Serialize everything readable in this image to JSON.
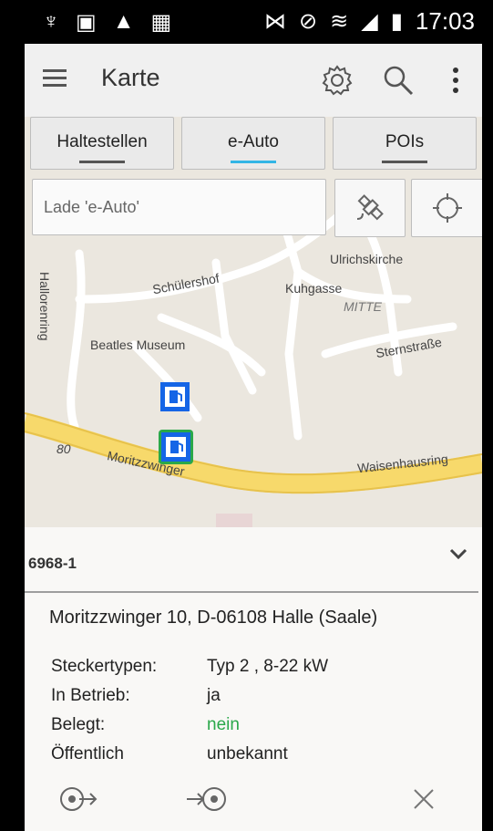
{
  "status": {
    "time": "17:03"
  },
  "app": {
    "title": "Karte"
  },
  "tabs": [
    "Haltestellen",
    "e-Auto",
    "POIs"
  ],
  "search": {
    "placeholder": "Lade 'e-Auto'"
  },
  "map": {
    "labels": [
      "Ulrichskirche",
      "Schülershof",
      "Kuhgasse",
      "MITTE",
      "Beatles Museum",
      "Sternstraße",
      "Waisenhausring",
      "Moritzzwinger",
      "80",
      "Hallorenring"
    ]
  },
  "station": {
    "id": "6968-1",
    "address": "Moritzzwinger 10, D-06108 Halle (Saale)",
    "details": [
      {
        "key": "Steckertypen:",
        "value": "Typ 2 , 8-22 kW"
      },
      {
        "key": "In Betrieb:",
        "value": "ja"
      },
      {
        "key": "Belegt:",
        "value": "nein"
      },
      {
        "key": "Öffentlich",
        "value": "unbekannt"
      }
    ]
  },
  "colors": {
    "accent": "#33b5e5",
    "green": "#2aa84a",
    "marker_blue": "#1565e6"
  },
  "icons": [
    "usb-icon",
    "image-icon",
    "warning-icon",
    "bag-icon",
    "nfc-icon",
    "alarm-icon",
    "wifi-icon",
    "signal-icon",
    "battery-icon",
    "menu-icon",
    "gear-icon",
    "search-icon",
    "more-icon",
    "satellite-icon",
    "crosshair-icon",
    "charging-station-icon",
    "chevron-down-icon",
    "route-from-icon",
    "route-to-icon",
    "close-icon"
  ]
}
